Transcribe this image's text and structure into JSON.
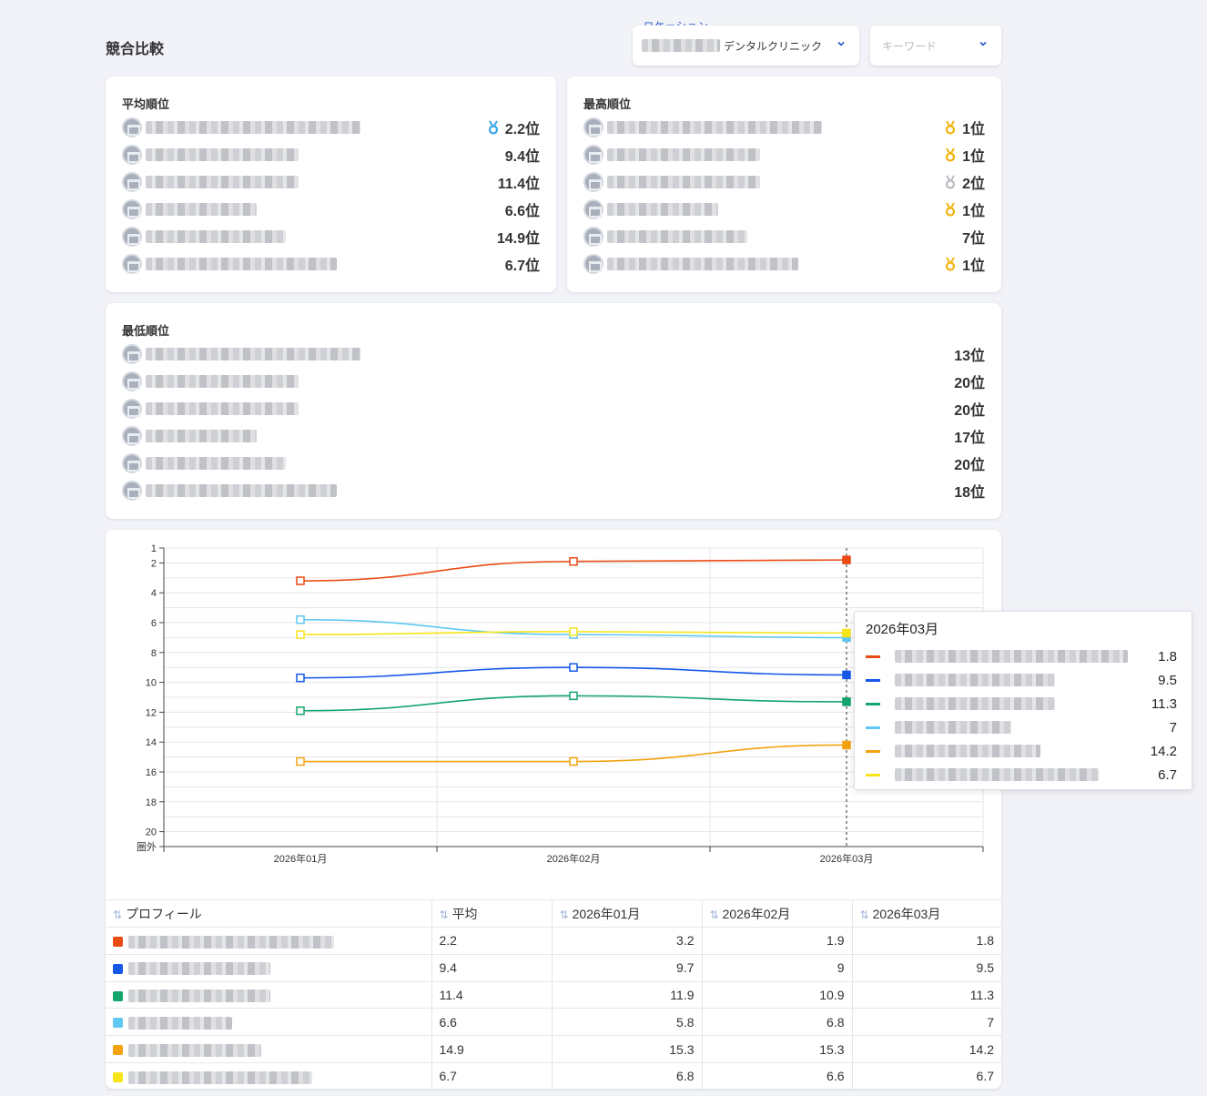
{
  "header": {
    "title": "競合比較",
    "location_label": "ロケーション",
    "location_value": "デンタルクリニック",
    "keyword_placeholder": "キーワード"
  },
  "colors": [
    "#ea4b14",
    "#1558e8",
    "#13a56c",
    "#5ec8f2",
    "#f2a20f",
    "#f7e51a"
  ],
  "avg_rank": {
    "title": "平均順位",
    "rows": [
      {
        "value": "2.2位",
        "medal": "blue"
      },
      {
        "value": "9.4位",
        "medal": ""
      },
      {
        "value": "11.4位",
        "medal": ""
      },
      {
        "value": "6.6位",
        "medal": ""
      },
      {
        "value": "14.9位",
        "medal": ""
      },
      {
        "value": "6.7位",
        "medal": ""
      }
    ]
  },
  "best_rank": {
    "title": "最高順位",
    "rows": [
      {
        "value": "1位",
        "medal": "gold"
      },
      {
        "value": "1位",
        "medal": "gold"
      },
      {
        "value": "2位",
        "medal": "silver"
      },
      {
        "value": "1位",
        "medal": "gold"
      },
      {
        "value": "7位",
        "medal": ""
      },
      {
        "value": "1位",
        "medal": "gold"
      }
    ]
  },
  "worst_rank": {
    "title": "最低順位",
    "rows": [
      {
        "value": "13位"
      },
      {
        "value": "20位"
      },
      {
        "value": "20位"
      },
      {
        "value": "17位"
      },
      {
        "value": "20位"
      },
      {
        "value": "18位"
      }
    ]
  },
  "chart_data": {
    "type": "line",
    "x": [
      "2026年01月",
      "2026年02月",
      "2026年03月"
    ],
    "y_ticks": [
      "1",
      "2",
      "4",
      "6",
      "8",
      "10",
      "12",
      "14",
      "16",
      "18",
      "20",
      "圏外"
    ],
    "ylim": [
      1,
      21
    ],
    "y_reversed": true,
    "grid": true,
    "series": [
      {
        "values": [
          3.2,
          1.9,
          1.8
        ],
        "color": "#ea4b14"
      },
      {
        "values": [
          9.7,
          9,
          9.5
        ],
        "color": "#1558e8"
      },
      {
        "values": [
          11.9,
          10.9,
          11.3
        ],
        "color": "#13a56c"
      },
      {
        "values": [
          5.8,
          6.8,
          7
        ],
        "color": "#5ec8f2"
      },
      {
        "values": [
          15.3,
          15.3,
          14.2
        ],
        "color": "#f2a20f"
      },
      {
        "values": [
          6.8,
          6.6,
          6.7
        ],
        "color": "#f7e51a"
      }
    ],
    "tooltip": {
      "title": "2026年03月",
      "values": [
        "1.8",
        "9.5",
        "11.3",
        "7",
        "14.2",
        "6.7"
      ]
    }
  },
  "table": {
    "headers": [
      "プロフィール",
      "平均",
      "2026年01月",
      "2026年02月",
      "2026年03月"
    ],
    "rows": [
      {
        "color": "#ea4b14",
        "avg": "2.2",
        "m1": "3.2",
        "m2": "1.9",
        "m3": "1.8"
      },
      {
        "color": "#1558e8",
        "avg": "9.4",
        "m1": "9.7",
        "m2": "9",
        "m3": "9.5"
      },
      {
        "color": "#13a56c",
        "avg": "11.4",
        "m1": "11.9",
        "m2": "10.9",
        "m3": "11.3"
      },
      {
        "color": "#5ec8f2",
        "avg": "6.6",
        "m1": "5.8",
        "m2": "6.8",
        "m3": "7"
      },
      {
        "color": "#f2a20f",
        "avg": "14.9",
        "m1": "15.3",
        "m2": "15.3",
        "m3": "14.2"
      },
      {
        "color": "#f7e51a",
        "avg": "6.7",
        "m1": "6.8",
        "m2": "6.6",
        "m3": "6.7"
      }
    ]
  }
}
